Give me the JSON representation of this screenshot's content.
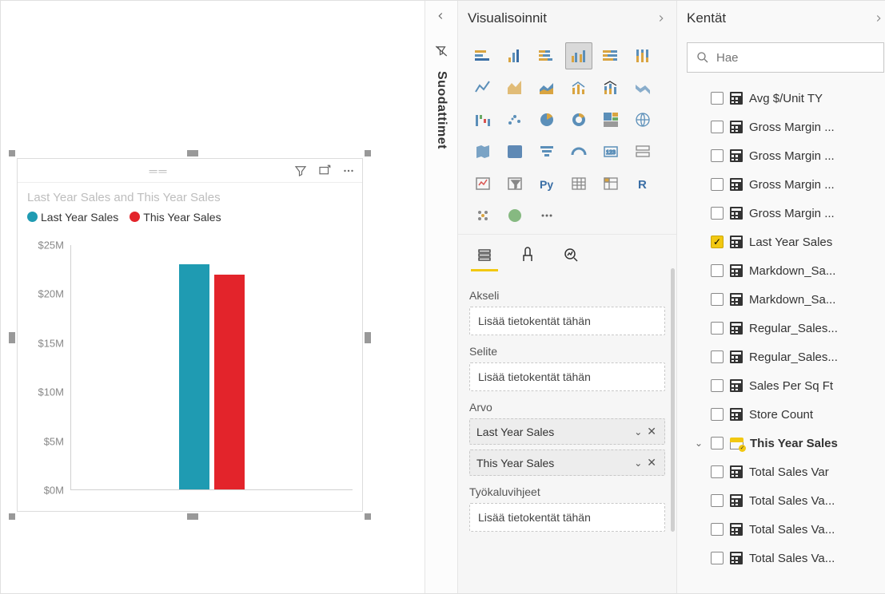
{
  "canvas": {
    "chart_title": "Last Year Sales and This Year Sales",
    "legend": [
      {
        "label": "Last Year Sales",
        "color": "#1f9bb2"
      },
      {
        "label": "This Year Sales",
        "color": "#e3242b"
      }
    ]
  },
  "chart_data": {
    "type": "bar",
    "title": "Last Year Sales and This Year Sales",
    "series": [
      {
        "name": "Last Year Sales",
        "values": [
          23000000
        ],
        "color": "#1f9bb2"
      },
      {
        "name": "This Year Sales",
        "values": [
          22000000
        ],
        "color": "#e3242b"
      }
    ],
    "categories": [
      ""
    ],
    "ylabel": "",
    "xlabel": "",
    "ylim": [
      0,
      25000000
    ],
    "y_ticks": [
      "$0M",
      "$5M",
      "$10M",
      "$15M",
      "$20M",
      "$25M"
    ]
  },
  "filters_pane": {
    "title": "Suodattimet"
  },
  "viz_pane": {
    "title": "Visualisoinnit",
    "wells": {
      "axis_label": "Akseli",
      "axis_placeholder": "Lisää tietokentät tähän",
      "legend_label": "Selite",
      "legend_placeholder": "Lisää tietokentät tähän",
      "value_label": "Arvo",
      "value_pills": [
        "Last Year Sales",
        "This Year Sales"
      ],
      "tooltip_label": "Työkaluvihjeet",
      "tooltip_placeholder": "Lisää tietokentät tähän"
    }
  },
  "fields_pane": {
    "title": "Kentät",
    "search_placeholder": "Hae",
    "fields": [
      {
        "label": "Avg $/Unit TY",
        "checked": false,
        "type": "calc"
      },
      {
        "label": "Gross Margin ...",
        "checked": false,
        "type": "calc"
      },
      {
        "label": "Gross Margin ...",
        "checked": false,
        "type": "calc"
      },
      {
        "label": "Gross Margin ...",
        "checked": false,
        "type": "calc"
      },
      {
        "label": "Gross Margin ...",
        "checked": false,
        "type": "calc"
      },
      {
        "label": "Last Year Sales",
        "checked": true,
        "type": "calc"
      },
      {
        "label": "Markdown_Sa...",
        "checked": false,
        "type": "calc"
      },
      {
        "label": "Markdown_Sa...",
        "checked": false,
        "type": "calc"
      },
      {
        "label": "Regular_Sales...",
        "checked": false,
        "type": "calc"
      },
      {
        "label": "Regular_Sales...",
        "checked": false,
        "type": "calc"
      },
      {
        "label": "Sales Per Sq Ft",
        "checked": false,
        "type": "calc"
      },
      {
        "label": "Store Count",
        "checked": false,
        "type": "calc"
      },
      {
        "label": "This Year Sales",
        "checked": false,
        "type": "table",
        "bold": true,
        "expandable": true
      },
      {
        "label": "Total Sales Var",
        "checked": false,
        "type": "calc"
      },
      {
        "label": "Total Sales Va...",
        "checked": false,
        "type": "calc"
      },
      {
        "label": "Total Sales Va...",
        "checked": false,
        "type": "calc"
      },
      {
        "label": "Total Sales Va...",
        "checked": false,
        "type": "calc"
      }
    ]
  }
}
